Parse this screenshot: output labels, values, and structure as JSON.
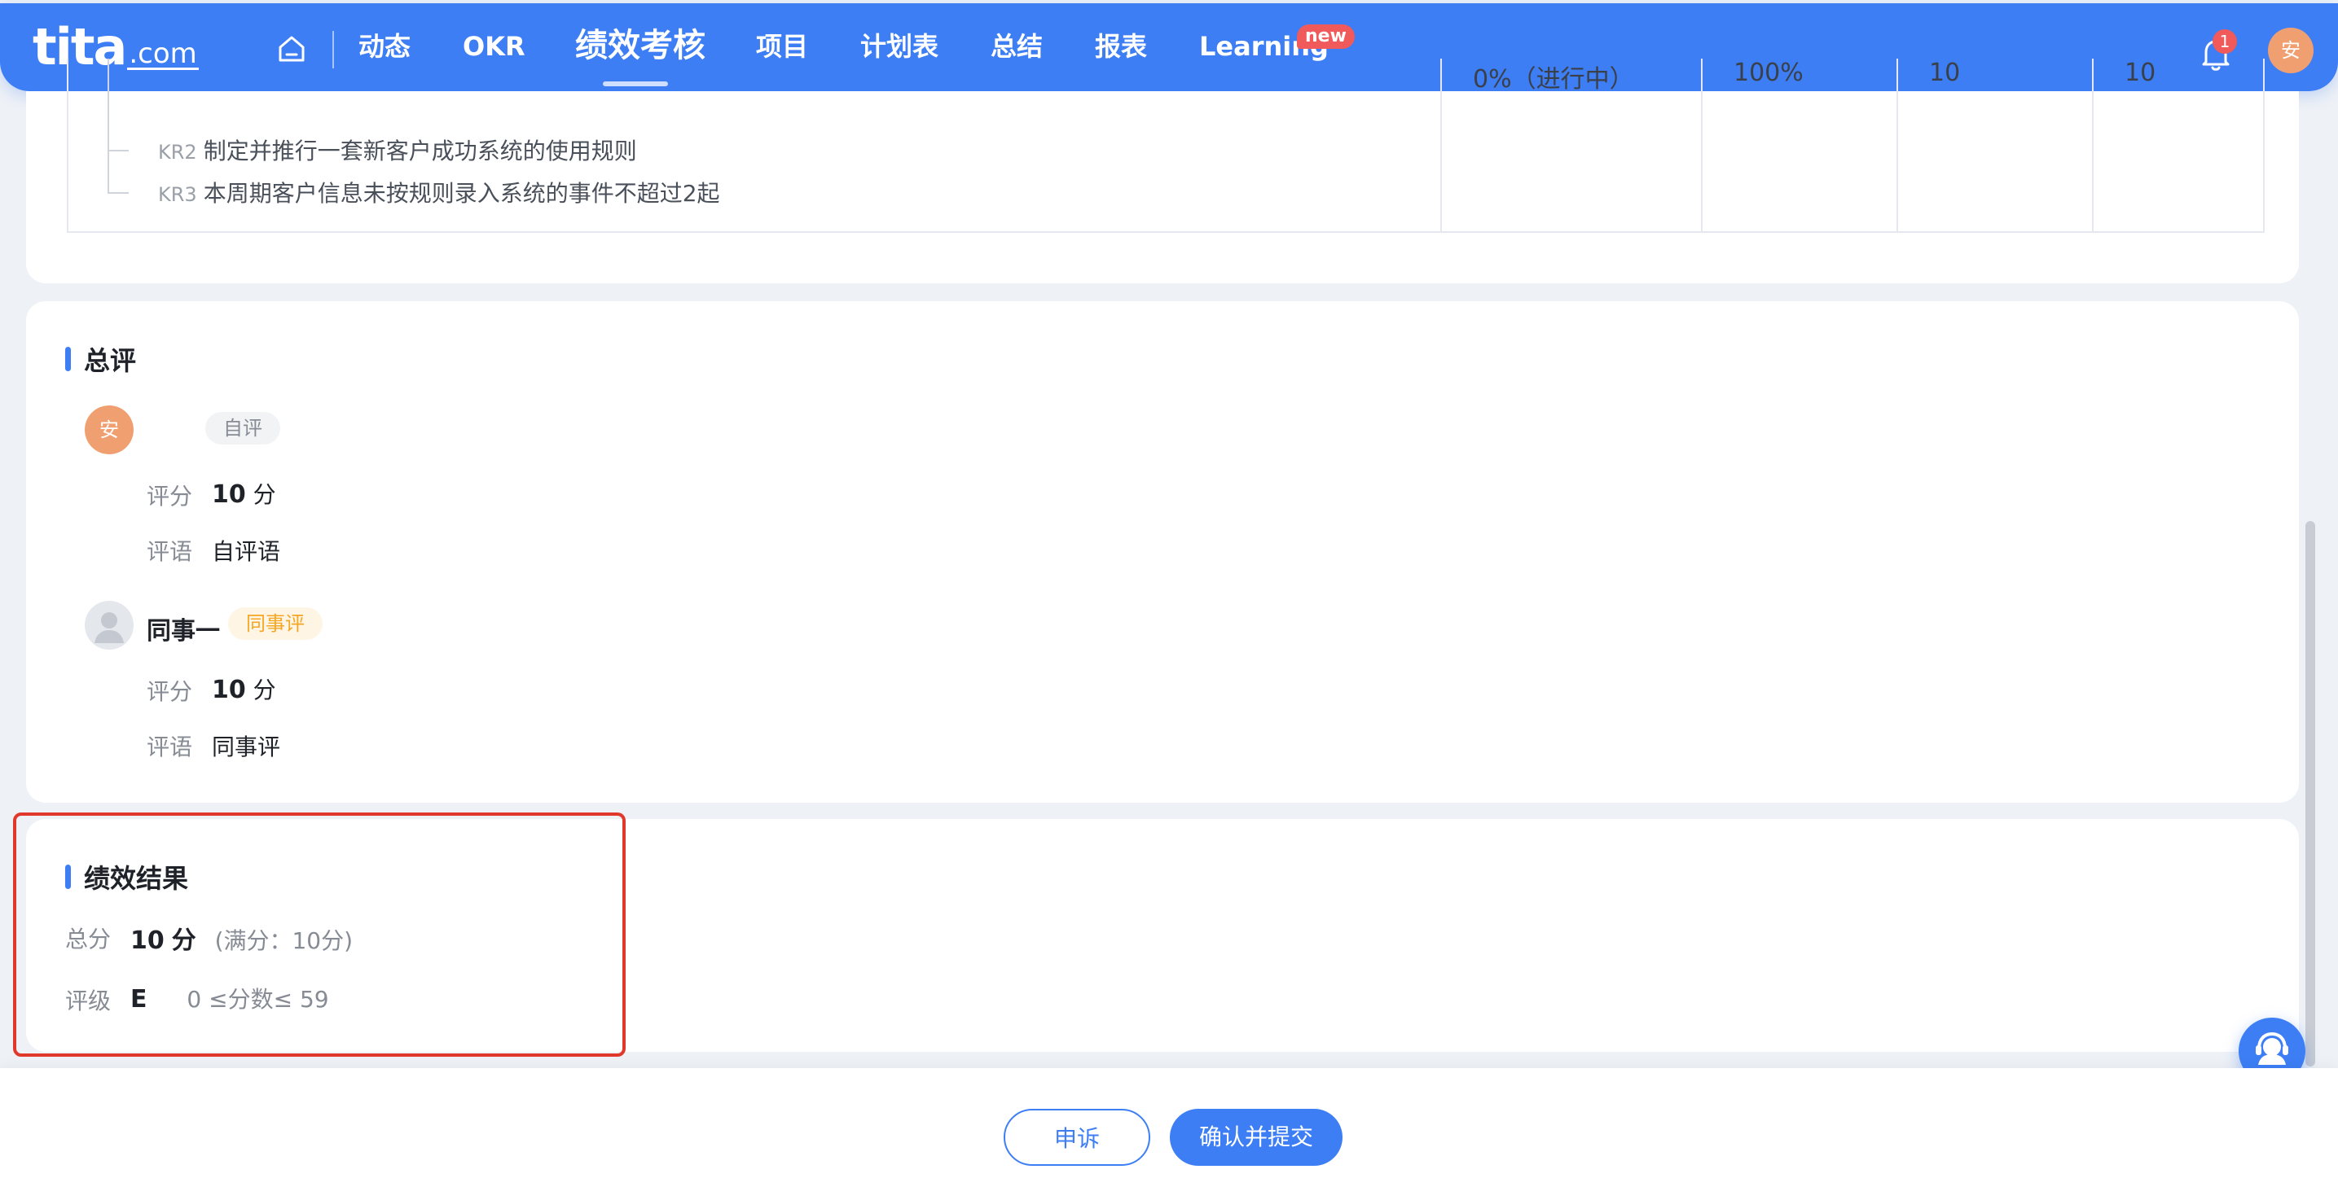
{
  "nav": {
    "logo_main": "tita",
    "logo_sub": ".com",
    "items": [
      "动态",
      "OKR",
      "绩效考核",
      "项目",
      "计划表",
      "总结",
      "报表",
      "Learning"
    ],
    "new_badge": "new",
    "notification_count": "1",
    "user_avatar": "安"
  },
  "okr": {
    "progress": "0%（进行中）",
    "weight": "100%",
    "score_a": "10",
    "score_b": "10",
    "krs": [
      {
        "tag": "KR2",
        "text": "制定并推行一套新客户成功系统的使用规则"
      },
      {
        "tag": "KR3",
        "text": "本周期客户信息未按规则录入系统的事件不超过2起"
      }
    ]
  },
  "evaluation": {
    "title": "总评",
    "self": {
      "avatar": "安",
      "tag": "自评",
      "score_label": "评分",
      "score_value": "10",
      "score_unit": "分",
      "comment_label": "评语",
      "comment": "自评语"
    },
    "peer": {
      "name": "同事一",
      "tag": "同事评",
      "score_label": "评分",
      "score_value": "10",
      "score_unit": "分",
      "comment_label": "评语",
      "comment": "同事评"
    }
  },
  "result": {
    "title": "绩效结果",
    "total_label": "总分",
    "total_value": "10",
    "total_unit": "分",
    "total_max": "(满分：10分)",
    "grade_label": "评级",
    "grade_value": "E",
    "grade_range": "0 ≤分数≤ 59"
  },
  "actions": {
    "appeal": "申诉",
    "confirm": "确认并提交"
  },
  "colors": {
    "primary": "#3d7ef5",
    "highlight": "#e0392b",
    "self_tag_bg": "#f2f3f5",
    "peer_tag_bg": "#fff5e5",
    "peer_tag_text": "#f5a623",
    "avatar": "#f0a070"
  }
}
